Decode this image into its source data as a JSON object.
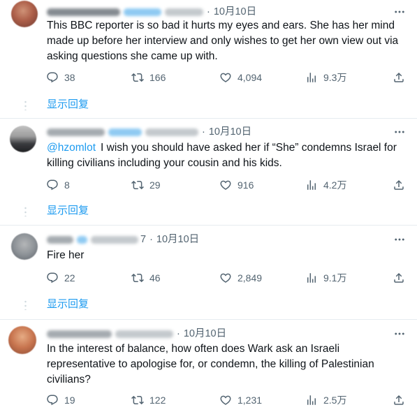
{
  "colors": {
    "text": "#0f1419",
    "secondary": "#536471",
    "link": "#1d9bf0",
    "divider": "#e6ecf0",
    "background": "#ffffff"
  },
  "icons": {
    "more": "more-icon",
    "thread": "thread-dots-icon"
  },
  "tweets": [
    {
      "separator": "·",
      "date": "10月10日",
      "lines": [
        "This BBC reporter is so bad it hurts my eyes and ears. She has her mind",
        "made up before her interview and only wishes to get her own view out via",
        "asking questions she came up with."
      ],
      "actions": [
        {
          "icon": "reply-icon",
          "count": "38"
        },
        {
          "icon": "retweet-icon",
          "count": "166"
        },
        {
          "icon": "like-icon",
          "count": "4,094"
        },
        {
          "icon": "views-icon",
          "count": "9.3万"
        },
        {
          "icon": "share-icon"
        }
      ],
      "show_replies": "显示回复"
    },
    {
      "separator": "·",
      "date": "10月10日",
      "mention": "@hzomlot",
      "lines": [
        "I wish you should have asked her if “She” condemns Israel for",
        "killing civilians including your cousin and his kids."
      ],
      "actions": [
        {
          "icon": "reply-icon",
          "count": "8"
        },
        {
          "icon": "retweet-icon",
          "count": "29"
        },
        {
          "icon": "like-icon",
          "count": "916"
        },
        {
          "icon": "views-icon",
          "count": "4.2万"
        },
        {
          "icon": "share-icon"
        }
      ],
      "show_replies": "显示回复"
    },
    {
      "handle_tail": "7",
      "separator": "·",
      "date": "10月10日",
      "lines": [
        "Fire her"
      ],
      "actions": [
        {
          "icon": "reply-icon",
          "count": "22"
        },
        {
          "icon": "retweet-icon",
          "count": "46"
        },
        {
          "icon": "like-icon",
          "count": "2,849"
        },
        {
          "icon": "views-icon",
          "count": "9.1万"
        },
        {
          "icon": "share-icon"
        }
      ],
      "show_replies": "显示回复"
    },
    {
      "separator": "·",
      "date": "10月10日",
      "lines": [
        "In the interest of balance, how often does Wark ask an Israeli",
        "representative to apologise for, or condemn, the killing of Palestinian",
        "civilians?"
      ],
      "actions": [
        {
          "icon": "reply-icon",
          "count": "19"
        },
        {
          "icon": "retweet-icon",
          "count": "122"
        },
        {
          "icon": "like-icon",
          "count": "1,231"
        },
        {
          "icon": "views-icon",
          "count": "2.5万"
        },
        {
          "icon": "share-icon"
        }
      ]
    }
  ]
}
